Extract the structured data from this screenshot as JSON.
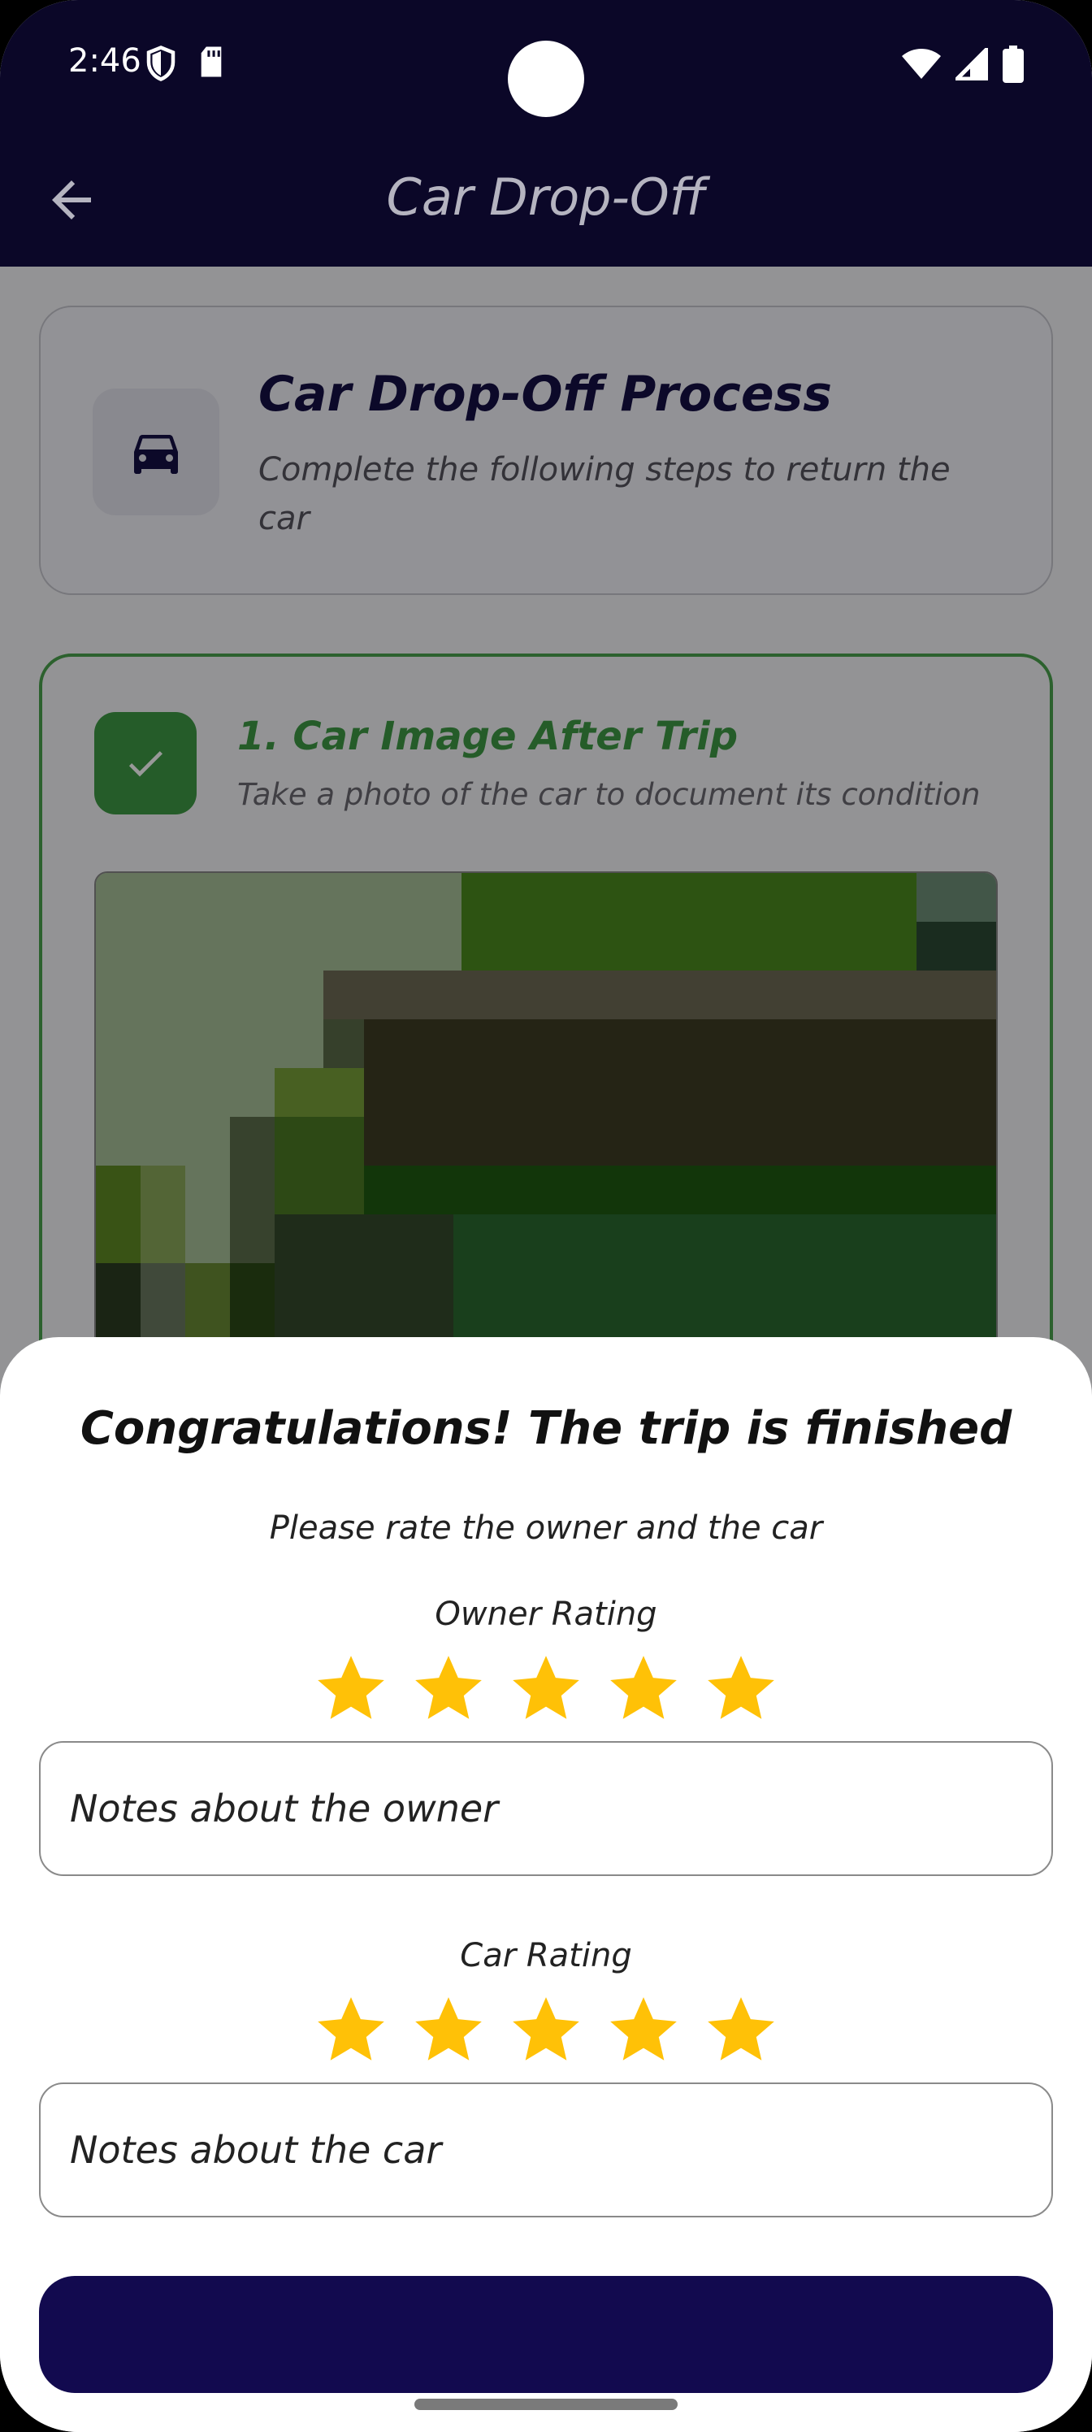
{
  "status_bar": {
    "time": "2:46",
    "left_icons": [
      "shield-icon",
      "sd-card-icon"
    ],
    "right_icons": [
      "wifi-icon",
      "signal-icon",
      "battery-icon"
    ]
  },
  "app_bar": {
    "title": "Car Drop-Off",
    "back_icon": "arrow-back-icon"
  },
  "process_card": {
    "icon": "car-icon",
    "title": "Car Drop-Off Process",
    "subtitle": "Complete the following steps to return the car"
  },
  "steps": [
    {
      "title": "1. Car Image After Trip",
      "subtitle": "Take a photo of the car to document its condition",
      "completed": true
    }
  ],
  "sheet": {
    "title": "Congratulations! The trip is finished",
    "subtitle": "Please rate the owner and the car",
    "owner_rating": {
      "label": "Owner Rating",
      "value": 5,
      "max": 5,
      "notes_placeholder": "Notes about the owner"
    },
    "car_rating": {
      "label": "Car Rating",
      "value": 5,
      "max": 5,
      "notes_placeholder": "Notes about the car"
    },
    "submit_label": ""
  },
  "colors": {
    "primary": "#120a4f",
    "app_bar": "#0b0728",
    "success": "#3e9a45",
    "star": "#ffc107"
  }
}
